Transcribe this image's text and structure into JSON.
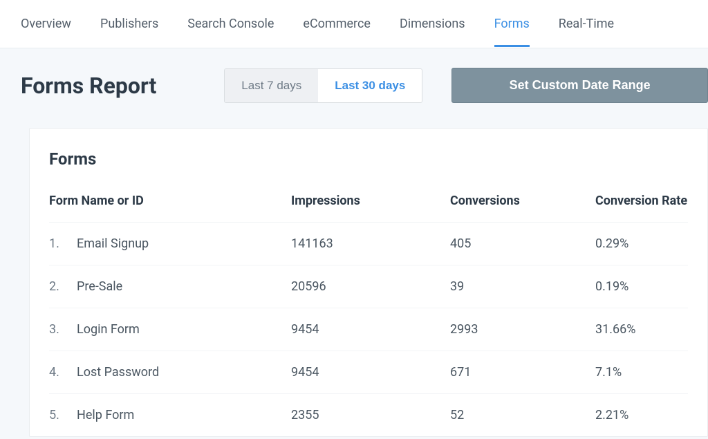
{
  "nav": {
    "tabs": [
      {
        "label": "Overview"
      },
      {
        "label": "Publishers"
      },
      {
        "label": "Search Console"
      },
      {
        "label": "eCommerce"
      },
      {
        "label": "Dimensions"
      },
      {
        "label": "Forms"
      },
      {
        "label": "Real-Time"
      }
    ],
    "active_index": 5
  },
  "page": {
    "title": "Forms Report"
  },
  "date_range": {
    "options": [
      {
        "label": "Last 7 days"
      },
      {
        "label": "Last 30 days"
      }
    ],
    "active_index": 1,
    "custom_button": "Set Custom Date Range"
  },
  "forms_card": {
    "title": "Forms",
    "columns": {
      "name": "Form Name or ID",
      "impressions": "Impressions",
      "conversions": "Conversions",
      "rate": "Conversion Rate"
    },
    "rows": [
      {
        "index": "1.",
        "name": "Email Signup",
        "impressions": "141163",
        "conversions": "405",
        "rate": "0.29%"
      },
      {
        "index": "2.",
        "name": "Pre-Sale",
        "impressions": "20596",
        "conversions": "39",
        "rate": "0.19%"
      },
      {
        "index": "3.",
        "name": "Login Form",
        "impressions": "9454",
        "conversions": "2993",
        "rate": "31.66%"
      },
      {
        "index": "4.",
        "name": "Lost Password",
        "impressions": "9454",
        "conversions": "671",
        "rate": "7.1%"
      },
      {
        "index": "5.",
        "name": "Help Form",
        "impressions": "2355",
        "conversions": "52",
        "rate": "2.21%"
      }
    ]
  }
}
